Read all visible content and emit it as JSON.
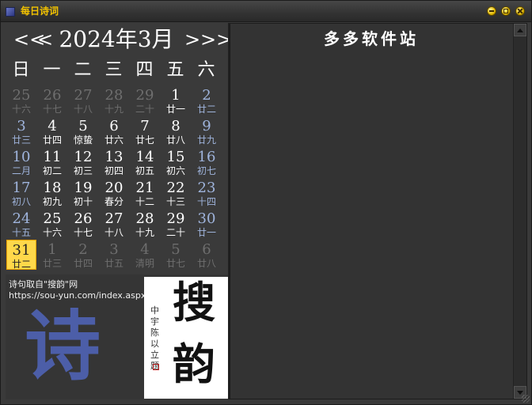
{
  "window": {
    "title": "每日诗词",
    "buttons": [
      "minimize-button",
      "maximize-button",
      "close-button"
    ],
    "accent_color": "#f2c200"
  },
  "calendar": {
    "nav": {
      "prev_year": "<<",
      "prev_month": "<",
      "next_month": ">",
      "next_year": ">>"
    },
    "month_title": "2024年3月",
    "weekdays": [
      "日",
      "一",
      "二",
      "三",
      "四",
      "五",
      "六"
    ],
    "weeks": [
      [
        {
          "d": "25",
          "l": "十六",
          "t": "other"
        },
        {
          "d": "26",
          "l": "十七",
          "t": "other"
        },
        {
          "d": "27",
          "l": "十八",
          "t": "other"
        },
        {
          "d": "28",
          "l": "十九",
          "t": "other"
        },
        {
          "d": "29",
          "l": "二十",
          "t": "other"
        },
        {
          "d": "1",
          "l": "廿一",
          "t": "cur"
        },
        {
          "d": "2",
          "l": "廿二",
          "t": "wkend"
        }
      ],
      [
        {
          "d": "3",
          "l": "廿三",
          "t": "wkend"
        },
        {
          "d": "4",
          "l": "廿四",
          "t": "cur"
        },
        {
          "d": "5",
          "l": "惊蛰",
          "t": "cur"
        },
        {
          "d": "6",
          "l": "廿六",
          "t": "cur"
        },
        {
          "d": "7",
          "l": "廿七",
          "t": "cur"
        },
        {
          "d": "8",
          "l": "廿八",
          "t": "cur"
        },
        {
          "d": "9",
          "l": "廿九",
          "t": "wkend"
        }
      ],
      [
        {
          "d": "10",
          "l": "二月",
          "t": "wkend"
        },
        {
          "d": "11",
          "l": "初二",
          "t": "cur"
        },
        {
          "d": "12",
          "l": "初三",
          "t": "cur"
        },
        {
          "d": "13",
          "l": "初四",
          "t": "cur"
        },
        {
          "d": "14",
          "l": "初五",
          "t": "cur"
        },
        {
          "d": "15",
          "l": "初六",
          "t": "cur"
        },
        {
          "d": "16",
          "l": "初七",
          "t": "wkend"
        }
      ],
      [
        {
          "d": "17",
          "l": "初八",
          "t": "wkend"
        },
        {
          "d": "18",
          "l": "初九",
          "t": "cur"
        },
        {
          "d": "19",
          "l": "初十",
          "t": "cur"
        },
        {
          "d": "20",
          "l": "春分",
          "t": "cur"
        },
        {
          "d": "21",
          "l": "十二",
          "t": "cur"
        },
        {
          "d": "22",
          "l": "十三",
          "t": "cur"
        },
        {
          "d": "23",
          "l": "十四",
          "t": "wkend"
        }
      ],
      [
        {
          "d": "24",
          "l": "十五",
          "t": "wkend"
        },
        {
          "d": "25",
          "l": "十六",
          "t": "cur"
        },
        {
          "d": "26",
          "l": "十七",
          "t": "cur"
        },
        {
          "d": "27",
          "l": "十八",
          "t": "cur"
        },
        {
          "d": "28",
          "l": "十九",
          "t": "cur"
        },
        {
          "d": "29",
          "l": "二十",
          "t": "cur"
        },
        {
          "d": "30",
          "l": "廿一",
          "t": "wkend"
        }
      ],
      [
        {
          "d": "31",
          "l": "廿二",
          "t": "today"
        },
        {
          "d": "1",
          "l": "廿三",
          "t": "other"
        },
        {
          "d": "2",
          "l": "廿四",
          "t": "other"
        },
        {
          "d": "3",
          "l": "廿五",
          "t": "other"
        },
        {
          "d": "4",
          "l": "清明",
          "t": "other"
        },
        {
          "d": "5",
          "l": "廿七",
          "t": "other"
        },
        {
          "d": "6",
          "l": "廿八",
          "t": "other"
        }
      ]
    ],
    "today_color": "#ffd84a",
    "weekend_color": "#9fb4dc"
  },
  "info": {
    "source_label": "诗句取自\"搜韵\"网",
    "source_url": "https://sou-yun.com/index.aspx",
    "big_char": "诗",
    "big_char_color": "#4c5ea8",
    "logo": {
      "char1": "搜",
      "char2": "韵",
      "signature": "中宇陈以立题"
    }
  },
  "poem": {
    "title": "多多软件站"
  }
}
